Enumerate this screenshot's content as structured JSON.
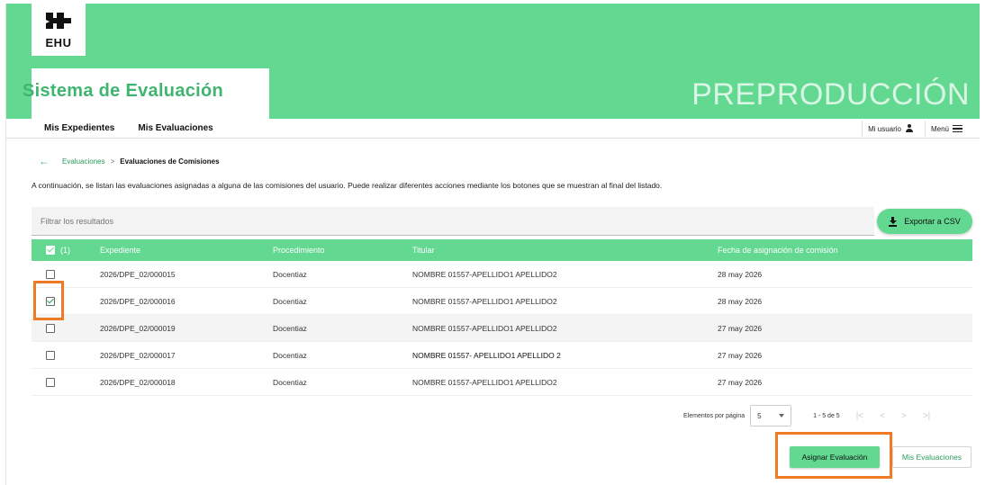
{
  "header": {
    "logo_text": "EHU",
    "system_title": "Sistema de Evaluación",
    "environment": "PREPRODUCCIÓN"
  },
  "nav": {
    "items": [
      {
        "label": "Mis Expedientes"
      },
      {
        "label": "Mis Evaluaciones"
      }
    ],
    "user_label": "Mi usuario",
    "menu_label": "Menú"
  },
  "breadcrumb": {
    "link": "Evaluaciones",
    "separator": ">",
    "current": "Evaluaciones de Comisiones"
  },
  "intro": "A continuación, se listan las evaluaciones asignadas a alguna de las comisiones del usuario. Puede realizar diferentes acciones mediante los botones que se muestran al final del listado.",
  "filter": {
    "placeholder": "Filtrar los resultados"
  },
  "export_label": "Exportar a CSV",
  "table": {
    "selected_count": "(1)",
    "columns": [
      "Expediente",
      "Procedimiento",
      "Titular",
      "Fecha de asignación de comisión"
    ],
    "rows": [
      {
        "checked": false,
        "expediente": "2026/DPE_02/000015",
        "procedimiento": "Docentiaz",
        "titular": "NOMBRE 01557-APELLIDO1 APELLIDO2",
        "fecha": "28 may 2026"
      },
      {
        "checked": true,
        "expediente": "2026/DPE_02/000016",
        "procedimiento": "Docentiaz",
        "titular": "NOMBRE 01557-APELLIDO1 APELLIDO2",
        "fecha": "28 may 2026"
      },
      {
        "checked": false,
        "expediente": "2026/DPE_02/000019",
        "procedimiento": "Docentiaz",
        "titular": "NOMBRE 01557-APELLIDO1 APELLIDO2",
        "fecha": "27 may 2026"
      },
      {
        "checked": false,
        "expediente": "2026/DPE_02/000017",
        "procedimiento": "Docentiaz",
        "titular": "NOMBRE 01557- APELLIDO1 APELLIDO 2",
        "fecha": "27 may 2026"
      },
      {
        "checked": false,
        "expediente": "2026/DPE_02/000018",
        "procedimiento": "Docentiaz",
        "titular": "NOMBRE 01557-APELLIDO1 APELLIDO2",
        "fecha": "27 may 2026"
      }
    ]
  },
  "pager": {
    "label": "Elementos por página",
    "page_size": "5",
    "range": "1 - 5 de 5",
    "first": "|<",
    "prev": "<",
    "next": ">",
    "last": ">|"
  },
  "actions": {
    "assign": "Asignar Evaluación",
    "my_evaluations": "Mis Evaluaciones"
  },
  "colors": {
    "brand_green": "#62d890",
    "highlight_orange": "#f07a24"
  }
}
